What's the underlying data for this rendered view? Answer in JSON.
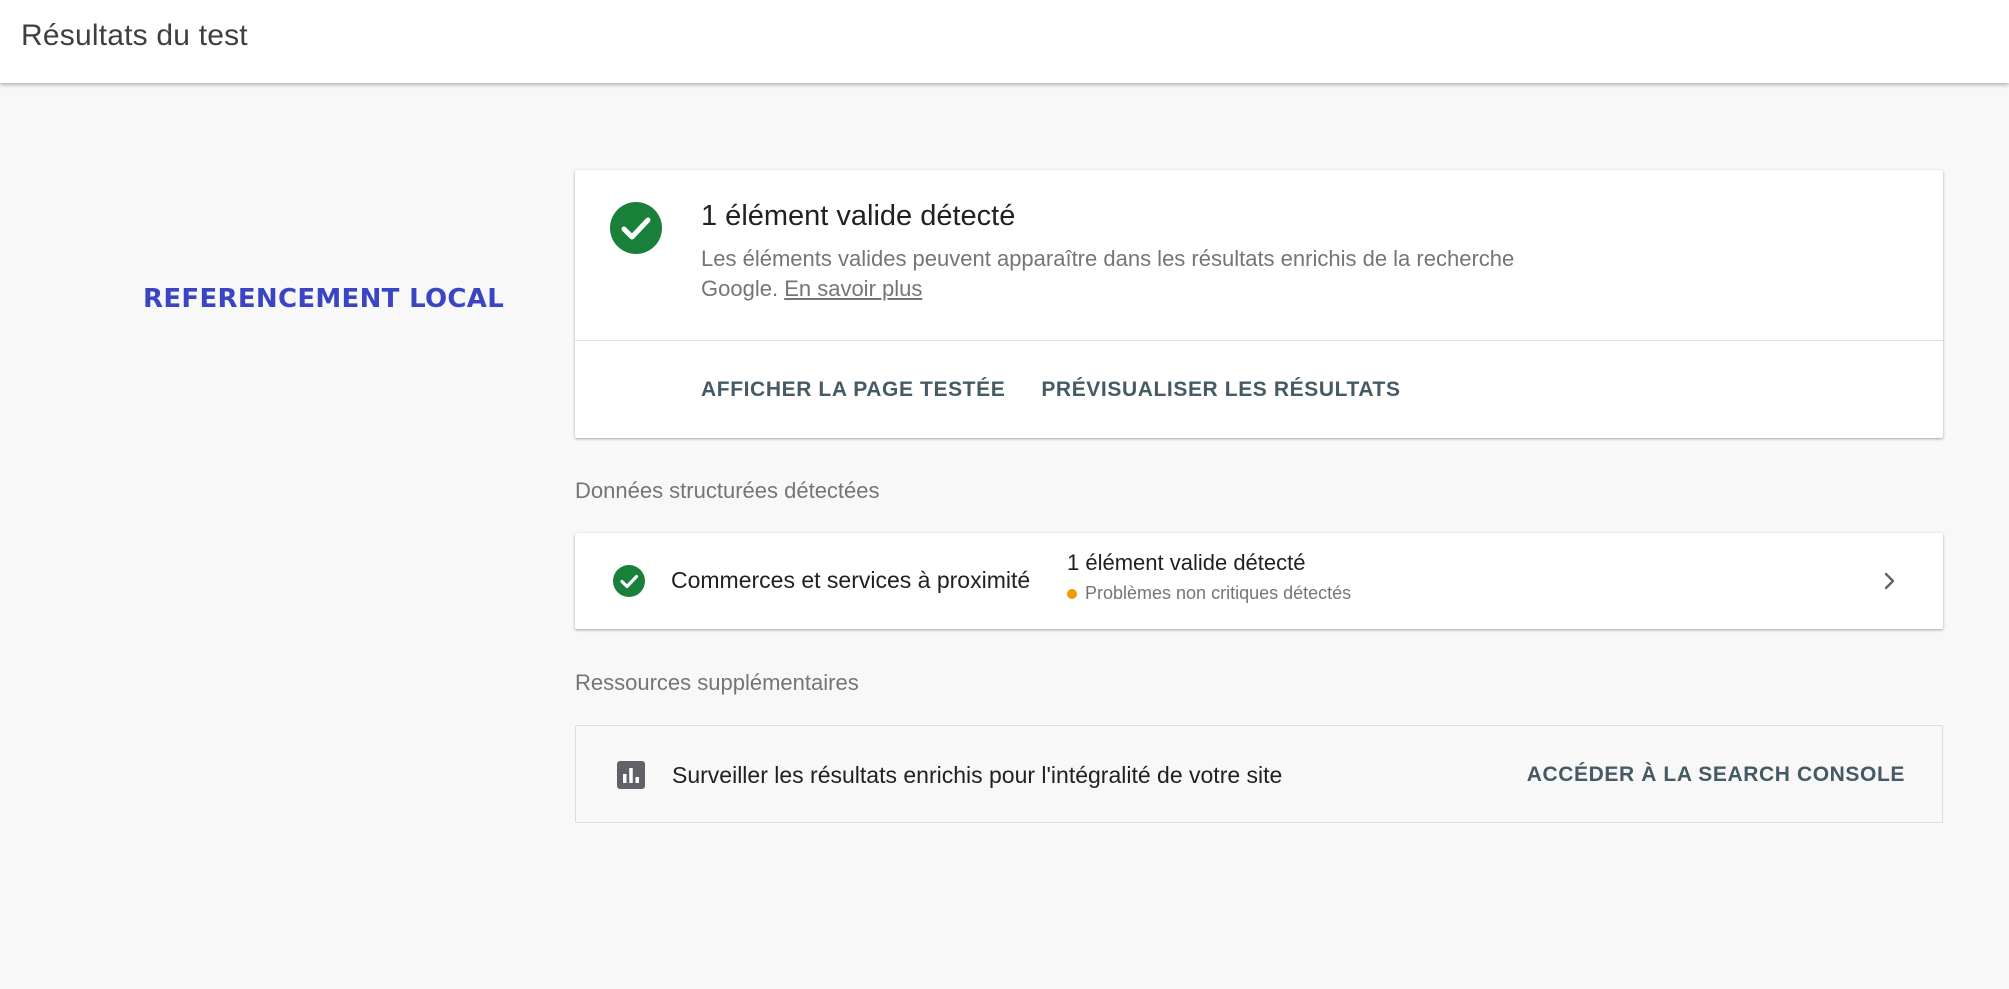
{
  "header": {
    "title": "Résultats du test"
  },
  "side_label": "REFERENCEMENT LOCAL",
  "summary": {
    "headline": "1 élément valide détecté",
    "description": "Les éléments valides peuvent apparaître dans les résultats enrichis de la recherche Google.",
    "learn_more": "En savoir plus",
    "actions": {
      "view_page": "AFFICHER LA PAGE TESTÉE",
      "preview_results": "PRÉVISUALISER LES RÉSULTATS"
    }
  },
  "structured_data": {
    "section_title": "Données structurées détectées",
    "items": [
      {
        "name": "Commerces et services à proximité",
        "count_text": "1 élément valide détecté",
        "warning_text": "Problèmes non critiques détectés"
      }
    ]
  },
  "resources": {
    "section_title": "Ressources supplémentaires",
    "text": "Surveiller les résultats enrichis pour l'intégralité de votre site",
    "link": "ACCÉDER À LA SEARCH CONSOLE"
  },
  "colors": {
    "success": "#188038",
    "warning": "#f29900",
    "side_label": "#3b45c4",
    "action_text": "#455a64"
  },
  "icons": {
    "summary_status": "check-circle-icon",
    "item_status": "check-circle-icon",
    "item_open": "chevron-right-icon",
    "resources": "bar-chart-icon"
  }
}
